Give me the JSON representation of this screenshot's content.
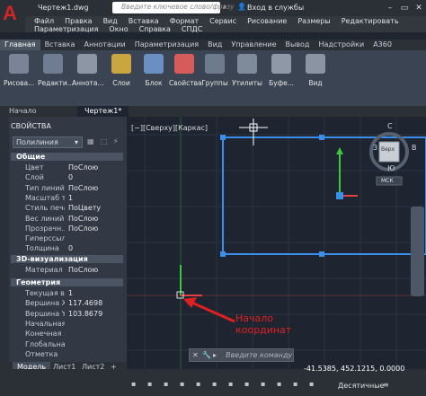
{
  "window": {
    "doc_title": "Чертеж1.dwg",
    "search_placeholder": "Введите ключевое слово/фразу",
    "signin": "Вход в службы"
  },
  "menu": {
    "row1": [
      "Файл",
      "Правка",
      "Вид",
      "Вставка",
      "Формат",
      "Сервис",
      "Рисование",
      "Размеры",
      "Редактировать"
    ],
    "row2": [
      "Параметризация",
      "Окно",
      "Справка",
      "СПДС"
    ]
  },
  "ribbon_tabs": [
    "Главная",
    "Вставка",
    "Аннотации",
    "Параметризация",
    "Вид",
    "Управление",
    "Вывод",
    "Надстройки",
    "A360"
  ],
  "ribbon_buttons": [
    "Рисова...",
    "Редакти...",
    "Аннота...",
    "Слои",
    "Блок",
    "Свойства",
    "Группы",
    "Утилиты",
    "Буфе...",
    "Вид"
  ],
  "doc_tabs": [
    "Начало",
    "Чертеж1*"
  ],
  "properties": {
    "title": "СВОЙСТВА",
    "selection": "Полилиния",
    "sections": {
      "general": "Общие",
      "viz3d": "3D-визуализация",
      "geometry": "Геометрия"
    },
    "general_rows": [
      {
        "k": "Цвет",
        "v": "ПоСлою"
      },
      {
        "k": "Слой",
        "v": "0"
      },
      {
        "k": "Тип линий",
        "v": "ПоСлою"
      },
      {
        "k": "Масштаб т...",
        "v": "1"
      },
      {
        "k": "Стиль печа...",
        "v": "ПоЦвету"
      },
      {
        "k": "Вес линий",
        "v": "ПоСлою"
      },
      {
        "k": "Прозрачн...",
        "v": "ПоСлою"
      },
      {
        "k": "Гиперссыл...",
        "v": ""
      },
      {
        "k": "Толщина",
        "v": "0"
      }
    ],
    "viz_rows": [
      {
        "k": "Материал",
        "v": "ПоСлою"
      }
    ],
    "geometry_rows": [
      {
        "k": "Текущая в...",
        "v": "1"
      },
      {
        "k": "Вершина X",
        "v": "117.4698"
      },
      {
        "k": "Вершина Y",
        "v": "103.8679"
      },
      {
        "k": "Начальная...",
        "v": ""
      },
      {
        "k": "Конечная ...",
        "v": ""
      },
      {
        "k": "Глобальна...",
        "v": ""
      },
      {
        "k": "Отметка",
        "v": ""
      }
    ]
  },
  "model_tabs": [
    "Модель",
    "Лист1",
    "Лист2"
  ],
  "viewport_label": "[−][Сверху][Каркас]",
  "viewcube": {
    "n": "С",
    "s": "Ю",
    "w": "З",
    "e": "В",
    "top": "Верх",
    "ucs": "МСК"
  },
  "command_placeholder": "Введите команду",
  "coordinates": "-41.5385, 452.1215, 0.0000",
  "units": "Десятичные",
  "annotation": {
    "line1": "Начало",
    "line2": "координат"
  },
  "colors": {
    "accent": "#3b8fe8",
    "arrow": "#e02020",
    "y_axis": "#3cc83c",
    "x_axis": "#e04040"
  }
}
